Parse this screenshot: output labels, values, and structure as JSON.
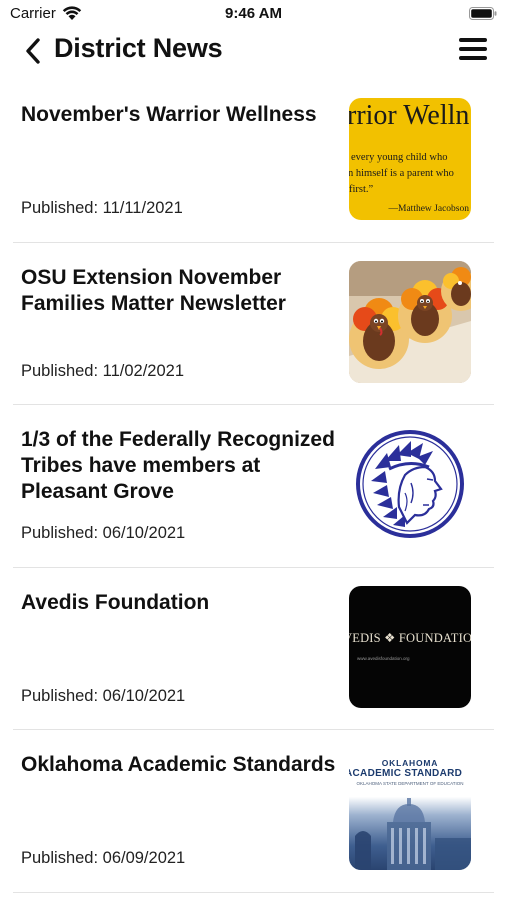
{
  "status_bar": {
    "carrier": "Carrier",
    "time": "9:46 AM"
  },
  "nav": {
    "title": "District News"
  },
  "articles": [
    {
      "title": "November's Warrior Wellness",
      "date": "Published: 11/11/2021",
      "thumb": {
        "headline": "rrior Welln",
        "line1": "every young child who",
        "line2": "n himself is a parent who",
        "line3": "first.”",
        "signature": "—Matthew Jacobson"
      }
    },
    {
      "title": "OSU Extension November Families Matter Newsletter",
      "date": "Published: 11/02/2021"
    },
    {
      "title": "1/3 of the Federally Recognized Tribes have members at Pleasant Grove",
      "date": "Published: 06/10/2021"
    },
    {
      "title": "Avedis Foundation",
      "date": "Published: 06/10/2021",
      "thumb": {
        "text": "VEDIS ❖ FOUNDATION",
        "url": "www.avedisfoundation.org"
      }
    },
    {
      "title": "Oklahoma Academic Standards",
      "date": "Published: 06/09/2021",
      "thumb": {
        "line1": "OKLAHOMA",
        "line2": "ACADEMIC STANDARD",
        "line3": "OKLAHOMA STATE DEPARTMENT OF EDUCATION"
      }
    }
  ],
  "colors": {
    "background": "#ffffff",
    "text": "#111111",
    "divider": "#e3e3e3",
    "yellow_thumb": "#f2c100",
    "logo_blue": "#2b2f9a"
  },
  "icons": [
    "wifi-icon",
    "battery-icon",
    "back-chevron-icon",
    "hamburger-menu-icon"
  ]
}
